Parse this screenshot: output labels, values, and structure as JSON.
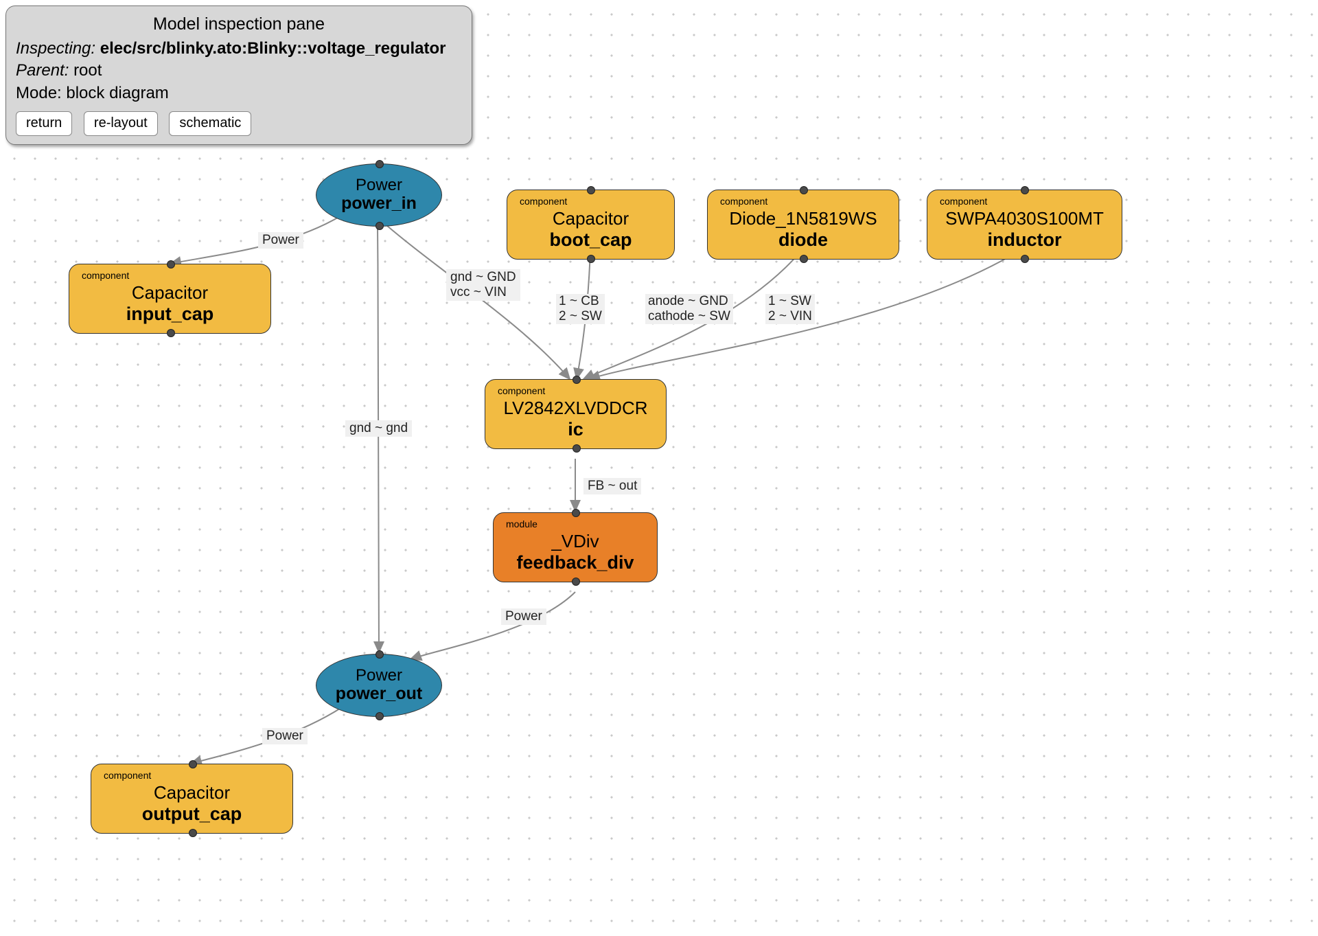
{
  "pane": {
    "title": "Model inspection pane",
    "inspecting_label": "Inspecting:",
    "inspecting_value": "elec/src/blinky.ato:Blinky::voltage_regulator",
    "parent_label": "Parent:",
    "parent_value": "root",
    "mode_label": "Mode:",
    "mode_value": "block diagram",
    "buttons": {
      "return": "return",
      "relayout": "re-layout",
      "schematic": "schematic"
    }
  },
  "nodes": {
    "power_in": {
      "type": "Power",
      "name": "power_in"
    },
    "power_out": {
      "type": "Power",
      "name": "power_out"
    },
    "input_cap": {
      "tag": "component",
      "type": "Capacitor",
      "name": "input_cap"
    },
    "boot_cap": {
      "tag": "component",
      "type": "Capacitor",
      "name": "boot_cap"
    },
    "diode": {
      "tag": "component",
      "type": "Diode_1N5819WS",
      "name": "diode"
    },
    "inductor": {
      "tag": "component",
      "type": "SWPA4030S100MT",
      "name": "inductor"
    },
    "ic": {
      "tag": "component",
      "type": "LV2842XLVDDCR",
      "name": "ic"
    },
    "feedback_div": {
      "tag": "module",
      "type": "_VDiv",
      "name": "feedback_div"
    },
    "output_cap": {
      "tag": "component",
      "type": "Capacitor",
      "name": "output_cap"
    }
  },
  "edge_labels": {
    "power_to_input_cap": "Power",
    "power_in_to_ic": "gnd ~ GND\nvcc ~ VIN",
    "gnd_gnd": "gnd ~ gnd",
    "boot_to_ic": "1 ~ CB\n2 ~ SW",
    "diode_to_ic": "anode ~ GND\ncathode ~ SW",
    "inductor_to_ic": "1 ~ SW\n2 ~ VIN",
    "ic_to_fb": "FB ~ out",
    "fb_to_out_power": "Power",
    "out_to_output_cap": "Power"
  }
}
